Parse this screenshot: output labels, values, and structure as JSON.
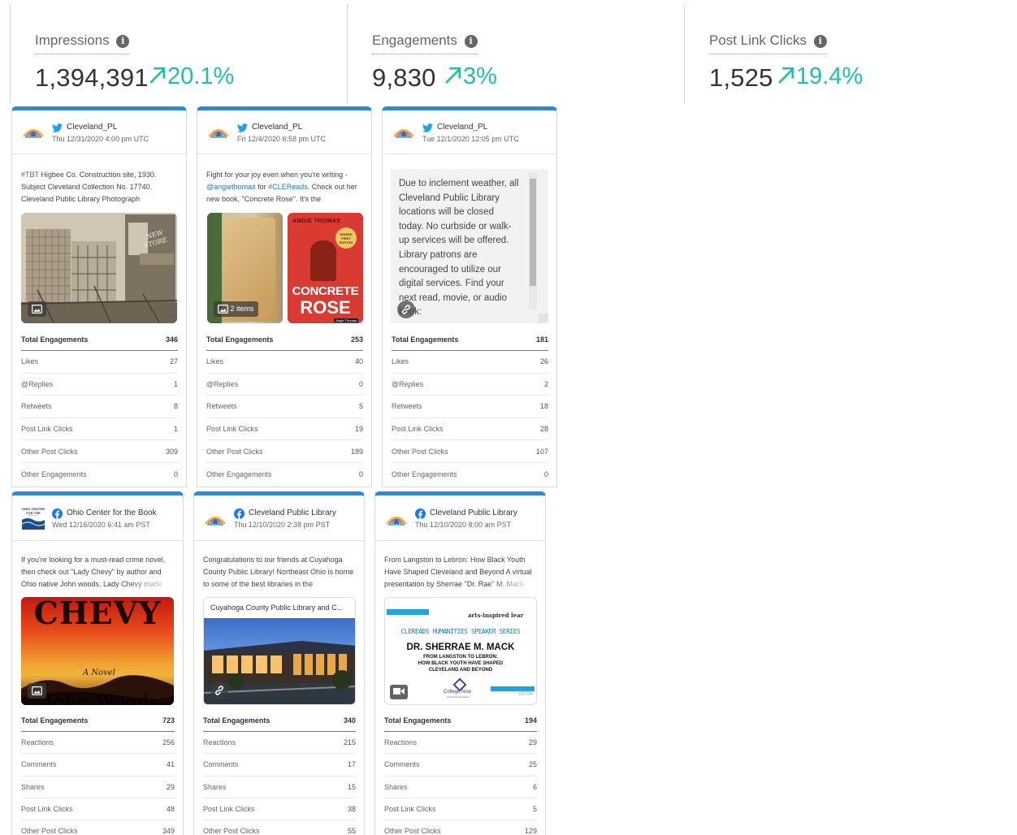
{
  "kpis": [
    {
      "label": "Impressions",
      "value": "1,394,391",
      "change": "20.1%"
    },
    {
      "label": "Engagements",
      "value": "9,830",
      "change": "3%"
    },
    {
      "label": "Post Link Clicks",
      "value": "1,525",
      "change": "19.4%"
    }
  ],
  "icons": {
    "info": "info-icon",
    "trend": "arrow-up-right-icon",
    "twitter": "twitter-icon",
    "facebook": "facebook-icon",
    "image": "image-icon",
    "link": "link-icon",
    "video": "video-icon"
  },
  "colors": {
    "accent": "#1f8fe6",
    "trend": "#20c0a8",
    "twitter": "#1da1f2",
    "facebook": "#1877f2"
  },
  "cards": [
    {
      "account": "Cleveland_PL",
      "date": "Thu 12/31/2020 4:00 pm UTC",
      "text": [
        "#TBT",
        " Higbee Co. Construction site, 1930. Subject Cleveland Collection No. 17740. Cleveland Public Library Photograph"
      ],
      "stats": [
        {
          "label": "Total Engagements",
          "value": "346"
        },
        {
          "label": "Likes",
          "value": "27"
        },
        {
          "label": "@Replies",
          "value": "1"
        },
        {
          "label": "Retweets",
          "value": "8"
        },
        {
          "label": "Post Link Clicks",
          "value": "1"
        },
        {
          "label": "Other Post Clicks",
          "value": "309"
        },
        {
          "label": "Other Engagements",
          "value": "0"
        }
      ]
    },
    {
      "account": "Cleveland_PL",
      "date": "Fri 12/4/2020 6:58 pm UTC",
      "text": [
        "Fight for your joy even when you're writing - ",
        "@angiethomas",
        " for ",
        "#CLEReads",
        ". Check out her new book, \"Concrete Rose\". It's the"
      ],
      "media_badge": "2 items",
      "book": {
        "author": "ANGIE THOMAS",
        "title_1": "CONCRETE",
        "title_2": "ROSE",
        "sticker": "SIGNED FIRST EDITION",
        "footer": "Angie Thomas"
      },
      "stats": [
        {
          "label": "Total Engagements",
          "value": "253"
        },
        {
          "label": "Likes",
          "value": "40"
        },
        {
          "label": "@Replies",
          "value": "0"
        },
        {
          "label": "Retweets",
          "value": "5"
        },
        {
          "label": "Post Link Clicks",
          "value": "19"
        },
        {
          "label": "Other Post Clicks",
          "value": "189"
        },
        {
          "label": "Other Engagements",
          "value": "0"
        }
      ]
    },
    {
      "account": "Cleveland_PL",
      "date": "Tue 12/1/2020 12:05 pm UTC",
      "scroll_text": "Due to inclement weather, all Cleveland Public Library locations will be closed today. No curbside or walk-up services will be offered. Library patrons are encouraged to utilize our digital services. Find your next read, movie, or audio book:",
      "stats": [
        {
          "label": "Total Engagements",
          "value": "181"
        },
        {
          "label": "Likes",
          "value": "26"
        },
        {
          "label": "@Replies",
          "value": "2"
        },
        {
          "label": "Retweets",
          "value": "18"
        },
        {
          "label": "Post Link Clicks",
          "value": "28"
        },
        {
          "label": "Other Post Clicks",
          "value": "107"
        },
        {
          "label": "Other Engagements",
          "value": "0"
        }
      ]
    },
    {
      "account": "Ohio Center for the Book",
      "date": "Wed 12/16/2020 6:41 am PST",
      "avatar_text": "OHIO CENTER FOR THE BOOK",
      "text": [
        "If you're looking for a must-read crime novel, then check out \"Lady Chevy\" by author and Ohio native John woods. Lady Chevy made"
      ],
      "book": {
        "title": "CHEVY",
        "subtitle": "A Novel",
        "author": "John Woods"
      },
      "stats": [
        {
          "label": "Total Engagements",
          "value": "723"
        },
        {
          "label": "Reactions",
          "value": "256"
        },
        {
          "label": "Comments",
          "value": "41"
        },
        {
          "label": "Shares",
          "value": "29"
        },
        {
          "label": "Post Link Clicks",
          "value": "48"
        },
        {
          "label": "Other Post Clicks",
          "value": "349"
        }
      ]
    },
    {
      "account": "Cleveland Public Library",
      "date": "Thu 12/10/2020 2:38 pm PST",
      "text": [
        "Congratulations to our friends at Cuyahoga County Public Library! Northeast Ohio is home to some of the best libraries in the"
      ],
      "link_title": "Cuyahoga County Public Library and C...",
      "stats": [
        {
          "label": "Total Engagements",
          "value": "340"
        },
        {
          "label": "Reactions",
          "value": "215"
        },
        {
          "label": "Comments",
          "value": "17"
        },
        {
          "label": "Shares",
          "value": "15"
        },
        {
          "label": "Post Link Clicks",
          "value": "38"
        },
        {
          "label": "Other Post Clicks",
          "value": "55"
        }
      ]
    },
    {
      "account": "Cleveland Public Library",
      "date": "Thu 12/10/2020 8:00 am PST",
      "text": [
        "From Langston to Lebron: How Black Youth Have Shaped Cleveland and Beyond A virtual presentation by Sherrae \"Dr. Rae\" M. Mack"
      ],
      "video": {
        "tagline": "arts-inspired lear",
        "series": "CLEREADS HUMANITIES SPEAKER SERIES",
        "speaker": "DR. SHERRAE M. MACK",
        "line1": "FROM LANGSTON TO LEBRON:",
        "line2": "HOW BLACK YOUTH HAVE SHAPED",
        "line3": "CLEVELAND AND BEYOND",
        "partner": "College Now",
        "partner_sub": "of Greater Cleveland",
        "duration": "00:04"
      },
      "stats": [
        {
          "label": "Total Engagements",
          "value": "194"
        },
        {
          "label": "Reactions",
          "value": "29"
        },
        {
          "label": "Comments",
          "value": "25"
        },
        {
          "label": "Shares",
          "value": "6"
        },
        {
          "label": "Post Link Clicks",
          "value": "5"
        },
        {
          "label": "Other Post Clicks",
          "value": "129"
        }
      ]
    }
  ]
}
